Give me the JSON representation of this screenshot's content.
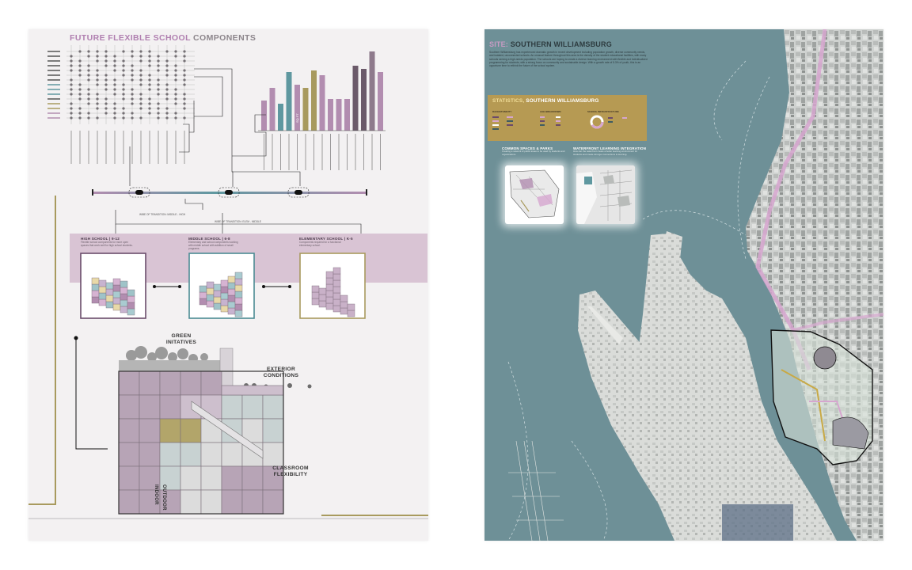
{
  "left_board": {
    "title_accent": "FUTURE FLEXIBLE SCHOOL",
    "title_rest": " COMPONENTS",
    "transition_labels": [
      "WIBE OF TRANSITION: MIDDLE - HIGH",
      "WIBE OF TRANSITION: ELEM - MIDDLE"
    ],
    "levels": [
      {
        "label": "HIGH SCHOOL | 9-12",
        "desc": "Flexible school components for more open spaces that work well for high school students."
      },
      {
        "label": "MIDDLE SCHOOL | 6-8",
        "desc": "Elementary and school components working with middle school with addition of small programs."
      },
      {
        "label": "ELEMENTARY SCHOOL | K-5",
        "desc": "Components required for a functional elementary school."
      }
    ],
    "bar_label": "SQ FT",
    "section_labels": {
      "green": "GREEN\nINITATIVES",
      "exterior": "EXTERIOR\nCONDITIONS",
      "classroom": "CLASSROOM\nFLEXIBILITY",
      "indoor": "INDOOR",
      "outdoor": "OUTDOOR"
    },
    "colors": {
      "purple": "#b28db0",
      "gold": "#a89a5e",
      "teal": "#5f98a0",
      "band": "#d9c4d4"
    }
  },
  "right_board": {
    "title_accent": "SITE:",
    "title_rest": " SOUTHERN WILLIAMSBURG",
    "intro": "Southern Williamsburg has experienced dramatic growth in recent development including population growth, diverse community needs, and isolated, unconnected schools. An unusual feature throughout this area is the density of the student educational facilities, with many schools serving a high-needs population. The schools are hoping to create a diverse learning environment with flexible and individualized programming for students, with a strong focus on community and sustainable design. With a growth rate of 5.3% of youth, this is an opportune time to rethink the future of the school system.",
    "stats": {
      "title_accent": "STATISTICS,",
      "title_rest": " SOUTHERN WILLIAMSBURG",
      "labels": [
        "RACE/ETHNICITY",
        "AGE BREAKDOWN",
        "SCHOOL INFRASTRUCTURE"
      ]
    },
    "panels": [
      {
        "title": "COMMON SPACES & PARKS",
        "desc": "Creating a network of public areas to be used by students and organizations."
      },
      {
        "title": "WATERFRONT LEARNING INTEGRATION",
        "desc": "How can the waterfront create a better learning environment for students and create stronger connections to learning."
      }
    ],
    "colors": {
      "water": "#6e9097",
      "pink": "#d6a6cf",
      "gold": "#b69a53"
    }
  }
}
